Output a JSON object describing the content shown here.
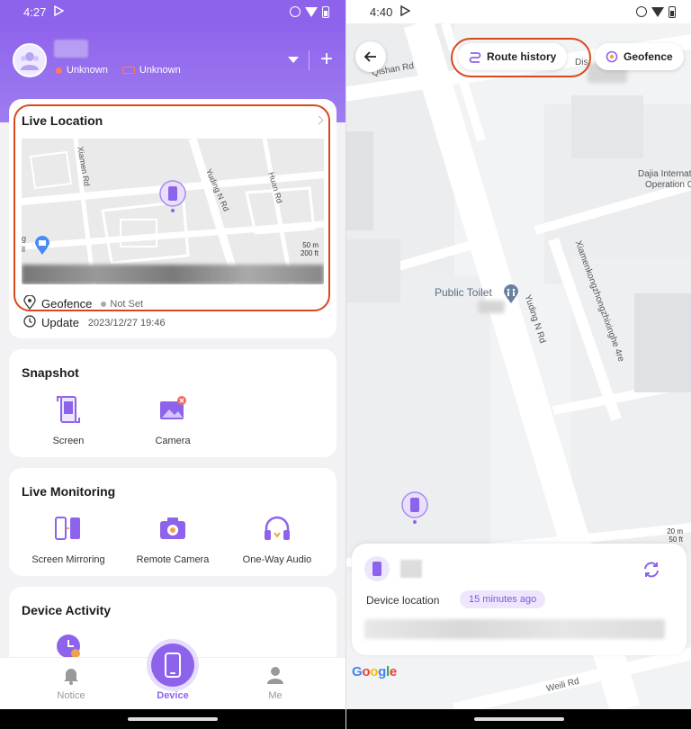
{
  "left": {
    "status_bar": {
      "time": "4:27"
    },
    "header": {
      "connection_status": "Unknown",
      "battery_status": "Unknown",
      "add_symbol": "+"
    },
    "live_location": {
      "title": "Live Location",
      "map_labels": {
        "road1": "Xiamen Rd",
        "road2": "Yuding N Rd",
        "road3": "Huan Rd",
        "scale_top": "50 m",
        "scale_bottom": "200 ft",
        "poi": "g",
        "poi2": "ll"
      },
      "geofence_label": "Geofence",
      "geofence_value": "Not Set",
      "update_label": "Update",
      "update_time": "2023/12/27 19:46"
    },
    "snapshot": {
      "title": "Snapshot",
      "items": [
        {
          "label": "Screen"
        },
        {
          "label": "Camera"
        }
      ]
    },
    "live_monitoring": {
      "title": "Live Monitoring",
      "items": [
        {
          "label": "Screen Mirroring"
        },
        {
          "label": "Remote Camera"
        },
        {
          "label": "One-Way Audio"
        }
      ]
    },
    "device_activity": {
      "title": "Device Activity"
    },
    "bottom_nav": {
      "notice": "Notice",
      "device": "Device",
      "me": "Me"
    }
  },
  "right": {
    "status_bar": {
      "time": "4:40"
    },
    "route_history": "Route history",
    "geofence": "Geofence",
    "map_labels": {
      "qishan": "Qishan Rd",
      "dis": "Dis",
      "dajia1": "Dajia Internat",
      "dajia2": "Operation C",
      "public_toilet": "Public Toilet",
      "yuding": "Yuding N Rd",
      "xiamenkong": "Xiamenkongzhongzhixinghe 4re",
      "scale_top": "20 m",
      "scale_bottom": "50 ft",
      "weili": "Weili Rd"
    },
    "sheet": {
      "device_location": "Device location",
      "time_ago": "15 minutes ago"
    },
    "google": "Google"
  },
  "colors": {
    "brand": "#8e63ec",
    "highlight": "#d9481c"
  }
}
